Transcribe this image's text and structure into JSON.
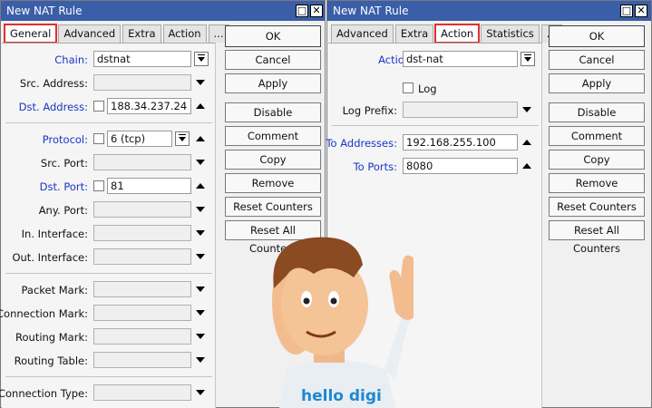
{
  "left_window": {
    "title": "New NAT Rule",
    "tabs": [
      "General",
      "Advanced",
      "Extra",
      "Action",
      "..."
    ],
    "fields": {
      "chain": {
        "label": "Chain:",
        "value": "dstnat"
      },
      "src_address": {
        "label": "Src. Address:",
        "value": ""
      },
      "dst_address": {
        "label": "Dst. Address:",
        "value": "188.34.237.24"
      },
      "protocol": {
        "label": "Protocol:",
        "value": "6 (tcp)"
      },
      "src_port": {
        "label": "Src. Port:",
        "value": ""
      },
      "dst_port": {
        "label": "Dst. Port:",
        "value": "81"
      },
      "any_port": {
        "label": "Any. Port:",
        "value": ""
      },
      "in_interface": {
        "label": "In. Interface:",
        "value": ""
      },
      "out_interface": {
        "label": "Out. Interface:",
        "value": ""
      },
      "packet_mark": {
        "label": "Packet Mark:",
        "value": ""
      },
      "connection_mark": {
        "label": "Connection Mark:",
        "value": ""
      },
      "routing_mark": {
        "label": "Routing Mark:",
        "value": ""
      },
      "routing_table": {
        "label": "Routing Table:",
        "value": ""
      },
      "connection_type": {
        "label": "Connection Type:",
        "value": ""
      }
    },
    "buttons": [
      "OK",
      "Cancel",
      "Apply",
      "Disable",
      "Comment",
      "Copy",
      "Remove",
      "Reset Counters",
      "Reset All Counters"
    ]
  },
  "right_window": {
    "title": "New NAT Rule",
    "tabs": [
      "Advanced",
      "Extra",
      "Action",
      "Statistics",
      "..."
    ],
    "fields": {
      "action": {
        "label": "Action:",
        "value": "dst-nat"
      },
      "log": {
        "label": "Log"
      },
      "log_prefix": {
        "label": "Log Prefix:",
        "value": ""
      },
      "to_addresses": {
        "label": "To Addresses:",
        "value": "192.168.255.100"
      },
      "to_ports": {
        "label": "To Ports:",
        "value": "8080"
      }
    },
    "buttons": [
      "OK",
      "Cancel",
      "Apply",
      "Disable",
      "Comment",
      "Copy",
      "Remove",
      "Reset Counters",
      "Reset All Counters"
    ]
  },
  "mascot": {
    "shirt_text": "hello digi"
  },
  "colors": {
    "titlebar": "#3a5ea8",
    "highlight": "#e03030",
    "label_blue": "#1836c8"
  }
}
